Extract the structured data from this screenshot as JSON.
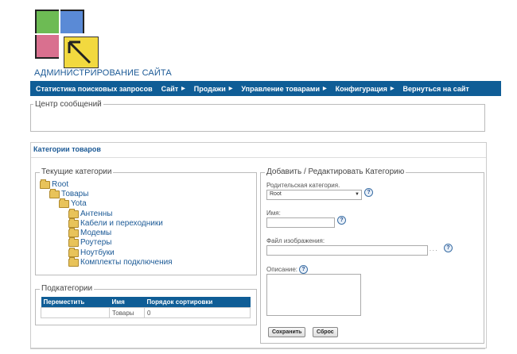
{
  "brand": {
    "title": "АДМИНИСТРИРОВАНИЕ САЙТА",
    "colors": {
      "green": "#6dbb54",
      "blue": "#5a8ad6",
      "pink": "#d9708f",
      "yellow": "#f2d93f"
    }
  },
  "menu": {
    "items": [
      {
        "label": "Статистика поисковых запросов",
        "arrow": ""
      },
      {
        "label": "Сайт",
        "arrow": "▶"
      },
      {
        "label": "Продажи",
        "arrow": "▶"
      },
      {
        "label": "Управление товарами",
        "arrow": "▶"
      },
      {
        "label": "Конфигурация",
        "arrow": "▶"
      },
      {
        "label": "Вернуться на сайт",
        "arrow": ""
      }
    ]
  },
  "messages": {
    "legend": "Центр сообщений"
  },
  "panel": {
    "title": "Категории товаров",
    "current_categories": {
      "legend": "Текущие категории",
      "tree": [
        "Root",
        "Товары",
        "Yota",
        "Антенны",
        "Кабели и переходники",
        "Модемы",
        "Роутеры",
        "Ноутбуки",
        "Комплекты подключения"
      ]
    },
    "subcategories": {
      "legend": "Подкатегории",
      "columns": [
        "Переместить",
        "Имя",
        "Порядок сортировки"
      ],
      "rows": [
        {
          "move": "",
          "name": "Товары",
          "order": "0"
        }
      ]
    },
    "edit_form": {
      "legend": "Добавить / Редактировать Категорию",
      "parent_label": "Родительская категория.",
      "parent_value": "Root",
      "name_label": "Имя:",
      "name_value": "",
      "image_label": "Файл изображения:",
      "image_value": "",
      "browse_dots": ". . .",
      "desc_label": "Описание:",
      "desc_value": "",
      "save_label": "Сохранить",
      "reset_label": "Сброс",
      "help_glyph": "?"
    }
  }
}
